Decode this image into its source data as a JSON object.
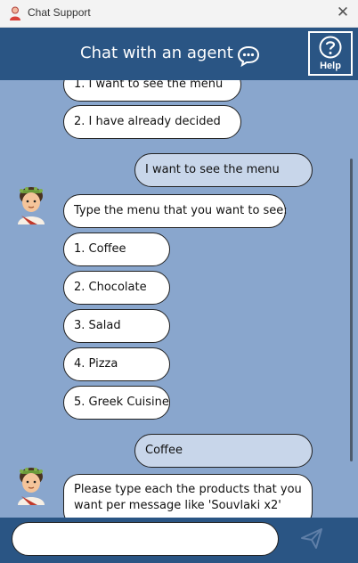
{
  "window": {
    "title": "Chat Support"
  },
  "header": {
    "title": "Chat with an agent",
    "help_label": "Help"
  },
  "messages": {
    "opt1": "1. I want to see the menu",
    "opt2": "2. I have already decided",
    "user1": "I want to see the menu",
    "bot1": "Type the menu that you want to see:",
    "menu": [
      "1. Coffee",
      "2. Chocolate",
      "3. Salad",
      "4. Pizza",
      "5. Greek Cuisine"
    ],
    "user2": "Coffee",
    "bot2": "Please type each the products that you want per message like 'Souvlaki x2'"
  },
  "input": {
    "value": "",
    "placeholder": ""
  },
  "colors": {
    "header": "#2a5584",
    "chat_bg": "#89a6cd",
    "user_bubble": "#c8d6ea"
  },
  "icons": {
    "app": "user-icon",
    "close": "close-icon",
    "chat": "speech-bubble-icon",
    "help": "question-icon",
    "send": "send-icon",
    "avatar": "agent-avatar"
  }
}
